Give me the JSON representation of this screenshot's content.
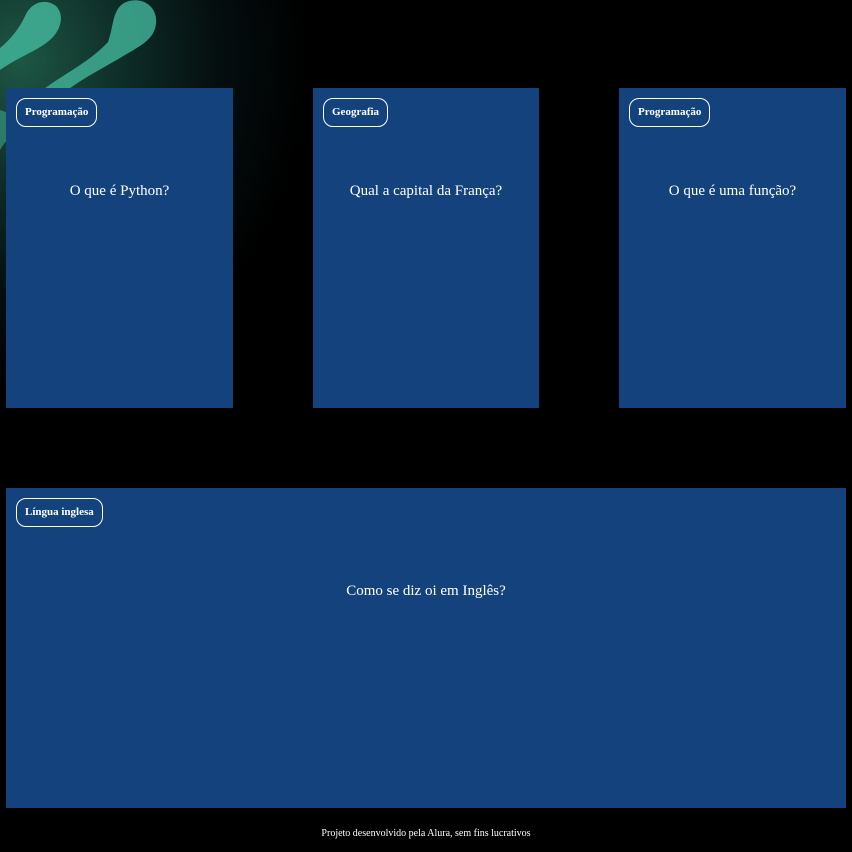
{
  "cards": [
    {
      "tag": "Programação",
      "question": "O que é Python?"
    },
    {
      "tag": "Geografia",
      "question": "Qual a capital da França?"
    },
    {
      "tag": "Programação",
      "question": "O que é uma função?"
    },
    {
      "tag": "Língua inglesa",
      "question": "Como se diz oi em Inglês?"
    }
  ],
  "footer": {
    "text": "Projeto desenvolvido pela Alura, sem fins lucrativos"
  },
  "colors": {
    "card_background": "#13427c",
    "page_background": "#000000",
    "decor_teal": "#3fae94",
    "text": "#ffffff"
  }
}
